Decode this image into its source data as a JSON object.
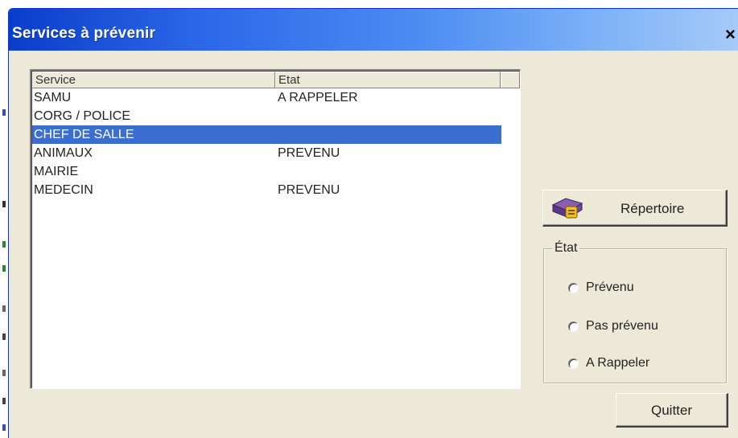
{
  "window": {
    "title": "Services à prévenir",
    "close_glyph": "×"
  },
  "list": {
    "columns": [
      "Service",
      "Etat"
    ],
    "rows": [
      {
        "service": "SAMU",
        "etat": "A RAPPELER",
        "selected": false
      },
      {
        "service": "CORG / POLICE",
        "etat": "",
        "selected": false
      },
      {
        "service": "CHEF DE SALLE",
        "etat": "",
        "selected": true
      },
      {
        "service": "ANIMAUX",
        "etat": "PREVENU",
        "selected": false
      },
      {
        "service": "MAIRIE",
        "etat": "",
        "selected": false
      },
      {
        "service": "MEDECIN",
        "etat": "PREVENU",
        "selected": false
      }
    ]
  },
  "repertoire": {
    "label": "Répertoire",
    "icon": "address-book-icon"
  },
  "etat_group": {
    "legend": "État",
    "options": [
      "Prévenu",
      "Pas prévenu",
      "A Rappeler"
    ]
  },
  "quit": {
    "label": "Quitter"
  },
  "colors": {
    "title_start": "#0a3ec9",
    "title_end": "#a9ccf9",
    "selection": "#3a6fd1",
    "face": "#ece9d8"
  }
}
